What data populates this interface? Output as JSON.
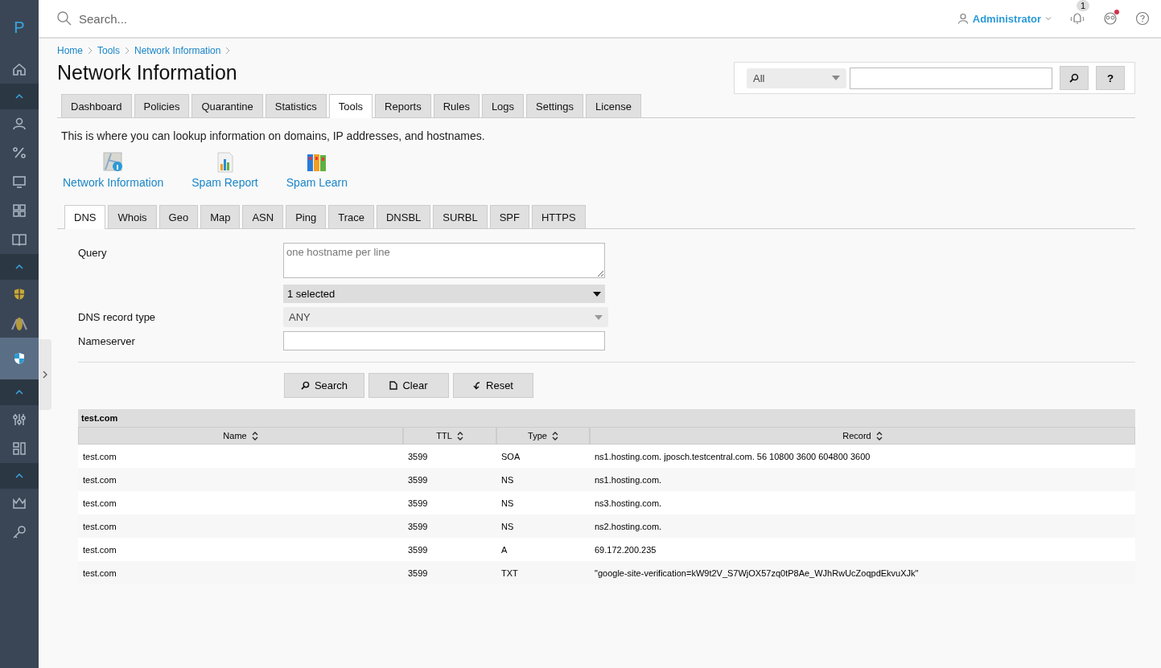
{
  "logo": "P",
  "sidebar": {
    "items": [
      {
        "kind": "icon",
        "selected": false
      },
      {
        "kind": "section",
        "selected": false
      },
      {
        "kind": "icon",
        "selected": false
      },
      {
        "kind": "icon",
        "selected": false
      },
      {
        "kind": "icon",
        "selected": false
      },
      {
        "kind": "icon",
        "selected": false
      },
      {
        "kind": "icon",
        "selected": false
      },
      {
        "kind": "section",
        "selected": false
      },
      {
        "kind": "icon",
        "selected": false
      },
      {
        "kind": "icon",
        "selected": false
      },
      {
        "kind": "icon",
        "selected": true
      },
      {
        "kind": "section",
        "selected": false
      },
      {
        "kind": "icon",
        "selected": false
      },
      {
        "kind": "icon",
        "selected": false
      },
      {
        "kind": "section",
        "selected": false
      },
      {
        "kind": "icon",
        "selected": false
      },
      {
        "kind": "icon",
        "selected": false
      }
    ]
  },
  "topbar": {
    "search_placeholder": "Search...",
    "user": "Administrator",
    "notification_count": "1",
    "alert_dot": true
  },
  "breadcrumb": [
    "Home",
    "Tools",
    "Network Information"
  ],
  "title": "Network Information",
  "quick_search": {
    "scope": "All",
    "help_label": "?"
  },
  "tabs": [
    {
      "label": "Dashboard",
      "selected": false
    },
    {
      "label": "Policies",
      "selected": false
    },
    {
      "label": "Quarantine",
      "selected": false
    },
    {
      "label": "Statistics",
      "selected": false
    },
    {
      "label": "Tools",
      "selected": true
    },
    {
      "label": "Reports",
      "selected": false
    },
    {
      "label": "Rules",
      "selected": false
    },
    {
      "label": "Logs",
      "selected": false
    },
    {
      "label": "Settings",
      "selected": false
    },
    {
      "label": "License",
      "selected": false
    }
  ],
  "intro": "This is where you can lookup information on domains, IP addresses, and hostnames.",
  "tools": [
    {
      "label": "Network Information"
    },
    {
      "label": "Spam Report"
    },
    {
      "label": "Spam Learn"
    }
  ],
  "subtabs": [
    {
      "label": "DNS",
      "selected": true
    },
    {
      "label": "Whois",
      "selected": false
    },
    {
      "label": "Geo",
      "selected": false
    },
    {
      "label": "Map",
      "selected": false
    },
    {
      "label": "ASN",
      "selected": false
    },
    {
      "label": "Ping",
      "selected": false
    },
    {
      "label": "Trace",
      "selected": false
    },
    {
      "label": "DNSBL",
      "selected": false
    },
    {
      "label": "SURBL",
      "selected": false
    },
    {
      "label": "SPF",
      "selected": false
    },
    {
      "label": "HTTPS",
      "selected": false
    }
  ],
  "form": {
    "query_label": "Query",
    "query_placeholder": "one hostname per line",
    "multi_select": "1 selected",
    "record_type_label": "DNS record type",
    "record_type": "ANY",
    "nameserver_label": "Nameserver"
  },
  "buttons": [
    "Search",
    "Clear",
    "Reset"
  ],
  "results": {
    "group": "test.com",
    "columns": [
      "Name",
      "TTL",
      "Type",
      "Record"
    ],
    "rows": [
      [
        "test.com",
        "3599",
        "SOA",
        "ns1.hosting.com. jposch.testcentral.com. 56 10800 3600 604800 3600"
      ],
      [
        "test.com",
        "3599",
        "NS",
        "ns1.hosting.com."
      ],
      [
        "test.com",
        "3599",
        "NS",
        "ns3.hosting.com."
      ],
      [
        "test.com",
        "3599",
        "NS",
        "ns2.hosting.com."
      ],
      [
        "test.com",
        "3599",
        "A",
        "69.172.200.235"
      ],
      [
        "test.com",
        "3599",
        "TXT",
        "\"google-site-verification=kW9t2V_S7WjOX57zq0tP8Ae_WJhRwUcZoqpdEkvuXJk\""
      ]
    ]
  }
}
